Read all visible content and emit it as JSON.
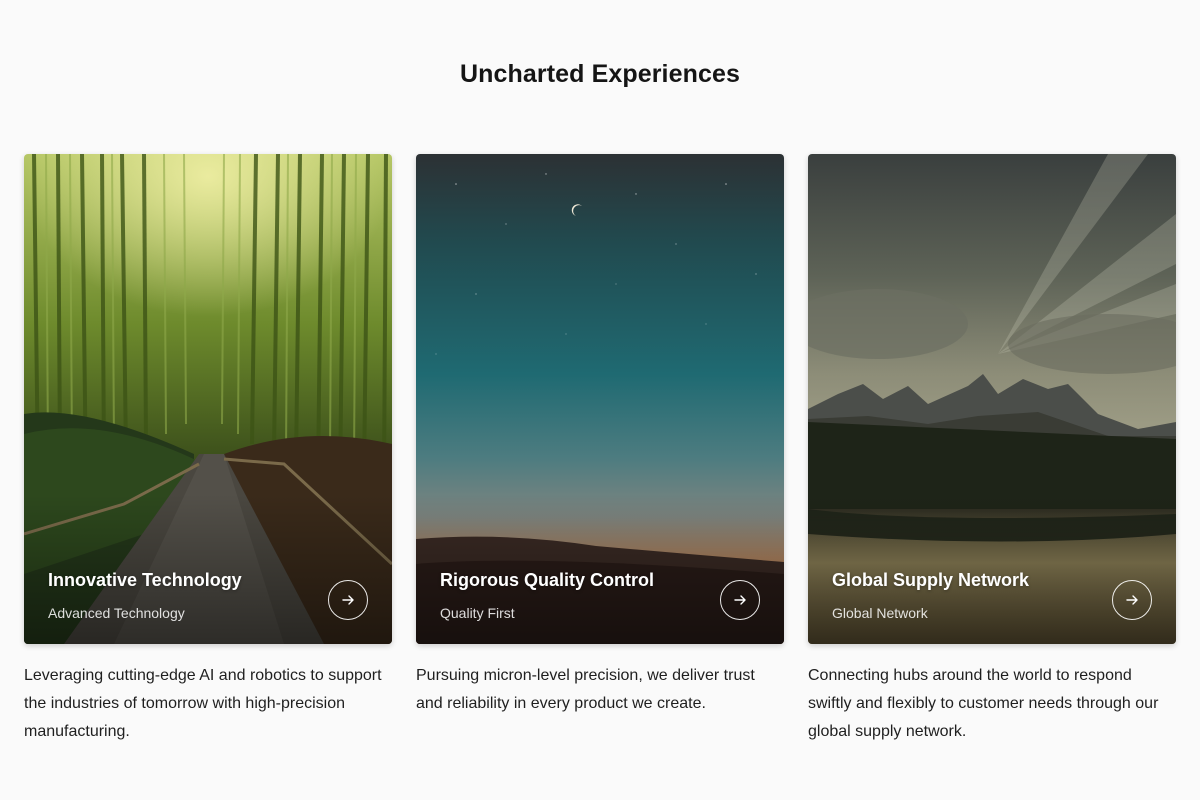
{
  "section": {
    "title": "Uncharted Experiences"
  },
  "cards": [
    {
      "title": "Innovative Technology",
      "subtitle": "Advanced Technology",
      "description": "Leveraging cutting-edge AI and robotics to support the industries of tomorrow with high-precision manufacturing.",
      "image": "bamboo-forest-path",
      "action_icon": "arrow-right-icon"
    },
    {
      "title": "Rigorous Quality Control",
      "subtitle": "Quality First",
      "description": "Pursuing micron-level precision, we deliver trust and reliability in every product we create.",
      "image": "twilight-sky-crescent-moon",
      "action_icon": "arrow-right-icon"
    },
    {
      "title": "Global Supply Network",
      "subtitle": "Global Network",
      "description": "Connecting hubs around the world to respond swiftly and flexibly to customer needs through our global supply network.",
      "image": "mountain-lake-sunrays",
      "action_icon": "arrow-right-icon"
    }
  ]
}
